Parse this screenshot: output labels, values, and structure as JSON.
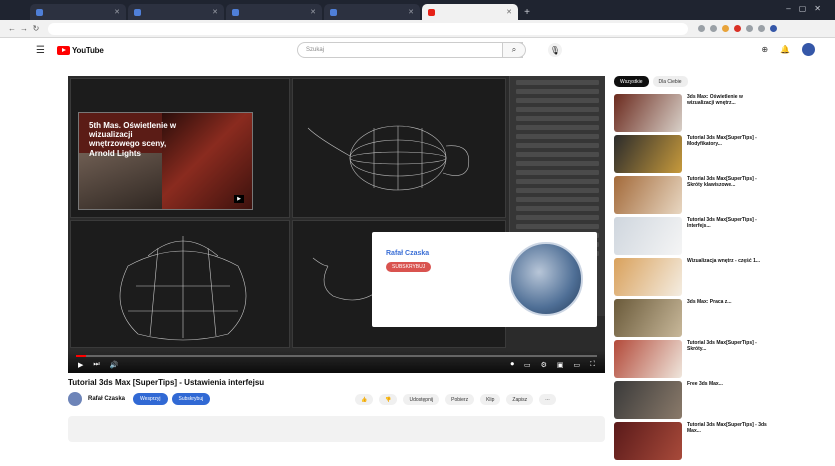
{
  "browser": {
    "tabs": [
      {
        "label": "",
        "active": false
      },
      {
        "label": "",
        "active": false
      },
      {
        "label": "",
        "active": false
      },
      {
        "label": "",
        "active": false
      },
      {
        "label": "",
        "active": true
      }
    ],
    "new_tab": "+",
    "url": ""
  },
  "youtube": {
    "logo_text": "YouTube",
    "search_placeholder": "Szukaj"
  },
  "player": {
    "overlay_title": "5th Mas. Oświetlenie w wizualizacji wnętrzowego sceny, Arnold Lights",
    "card": {
      "channel": "Rafał Czaska",
      "button": "SUBSKRYBUJ",
      "line1": "",
      "line2": ""
    },
    "time": "",
    "progress_fraction": 0.02
  },
  "video": {
    "title": "Tutorial 3ds Max [SuperTips] - Ustawienia interfejsu",
    "channel_name": "Rafał Czaska",
    "channel_subs": "",
    "join_label": "Wesprzyj",
    "subscribe_label": "Subskrybuj",
    "actions": [
      "",
      "",
      "Udostępnij",
      "Pobierz",
      "Klip",
      "Zapisz"
    ]
  },
  "description": {
    "line1": "",
    "line2": ""
  },
  "comments_label": "",
  "sidebar": {
    "chips": [
      "Wszystkie",
      "Dla Ciebie"
    ],
    "items": [
      {
        "title": "3ds Max: Oświetlenie w wizualizacji wnętrz...",
        "channel": "",
        "meta": "",
        "color1": "#6b2a1e",
        "color2": "#d8d0c8"
      },
      {
        "title": "Tutorial 3ds Max[SuperTips] - Modyfikatory...",
        "channel": "",
        "meta": "",
        "color1": "#2b2b2b",
        "color2": "#c79a3c"
      },
      {
        "title": "Tutorial 3ds Max[SuperTips] - Skróty klawiszowe...",
        "channel": "",
        "meta": "",
        "color1": "#a36a3a",
        "color2": "#e8d7c2"
      },
      {
        "title": "Tutorial 3ds Max[SuperTips] - Interfejs...",
        "channel": "",
        "meta": "",
        "color1": "#cfd6de",
        "color2": "#f5f5f5"
      },
      {
        "title": "Wizualizacja wnętrz - część 1...",
        "channel": "",
        "meta": "",
        "color1": "#d9a15c",
        "color2": "#f4ede2"
      },
      {
        "title": "3ds Max: Praca z...",
        "channel": "",
        "meta": "",
        "color1": "#6a5a3a",
        "color2": "#c8b89a"
      },
      {
        "title": "Tutorial 3ds Max[SuperTips] - Skróty...",
        "channel": "",
        "meta": "",
        "color1": "#b34a3a",
        "color2": "#efe6dc"
      },
      {
        "title": "Free 3ds Max...",
        "channel": "",
        "meta": "",
        "color1": "#3a3a3a",
        "color2": "#8a7a6a"
      },
      {
        "title": "Tutorial 3ds Max[SuperTips] - 3ds Max...",
        "channel": "",
        "meta": "",
        "color1": "#5a1a1a",
        "color2": "#a84a3a"
      }
    ]
  }
}
